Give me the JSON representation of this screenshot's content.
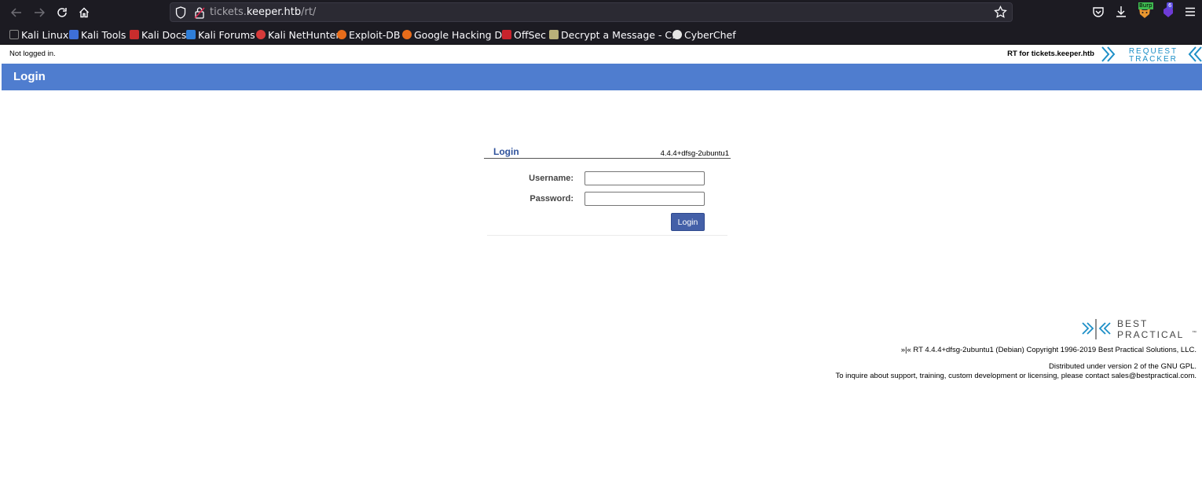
{
  "browser": {
    "url_prefix": "tickets.",
    "url_host": "keeper.htb",
    "url_path": "/rt/",
    "bookmarks": [
      {
        "label": "Kali Linux",
        "icon": "kali-dragon-icon"
      },
      {
        "label": "Kali Tools",
        "icon": "kali-tools-icon"
      },
      {
        "label": "Kali Docs",
        "icon": "kali-docs-icon"
      },
      {
        "label": "Kali Forums",
        "icon": "kali-forums-icon"
      },
      {
        "label": "Kali NetHunter",
        "icon": "kali-nethunter-icon"
      },
      {
        "label": "Exploit-DB",
        "icon": "exploit-db-icon"
      },
      {
        "label": "Google Hacking DB",
        "icon": "ghdb-icon"
      },
      {
        "label": "OffSec",
        "icon": "offsec-icon"
      },
      {
        "label": "Decrypt a Message - C...",
        "icon": "decrypt-icon"
      },
      {
        "label": "CyberChef",
        "icon": "cyberchef-icon"
      }
    ],
    "extension_badge": "6",
    "burp_label": "Burp"
  },
  "rt": {
    "not_logged_in": "Not logged in.",
    "rt_for": "RT for tickets.keeper.htb",
    "logo_line1": "REQUEST",
    "logo_line2": "TRACKER",
    "page_title": "Login",
    "login_box": {
      "title": "Login",
      "version": "4.4.4+dfsg-2ubuntu1",
      "username_label": "Username:",
      "username_value": "",
      "password_label": "Password:",
      "password_value": "",
      "submit_label": "Login"
    },
    "footer": {
      "bp_logo_line1": "BEST",
      "bp_logo_line2": "PRACTICAL",
      "bp_logo_tm": "™",
      "copyright": "»|« RT 4.4.4+dfsg-2ubuntu1 (Debian) Copyright 1996-2019 Best Practical Solutions, LLC.",
      "license": "Distributed under version 2 of the GNU GPL.",
      "contact": "To inquire about support, training, custom development or licensing, please contact sales@bestpractical.com."
    }
  },
  "colors": {
    "chrome_bg": "#1c1b22",
    "header_blue": "#4f7dcf",
    "login_title": "#30539c",
    "button_blue": "#4460a8",
    "logo_teal": "#1d8fc7"
  }
}
